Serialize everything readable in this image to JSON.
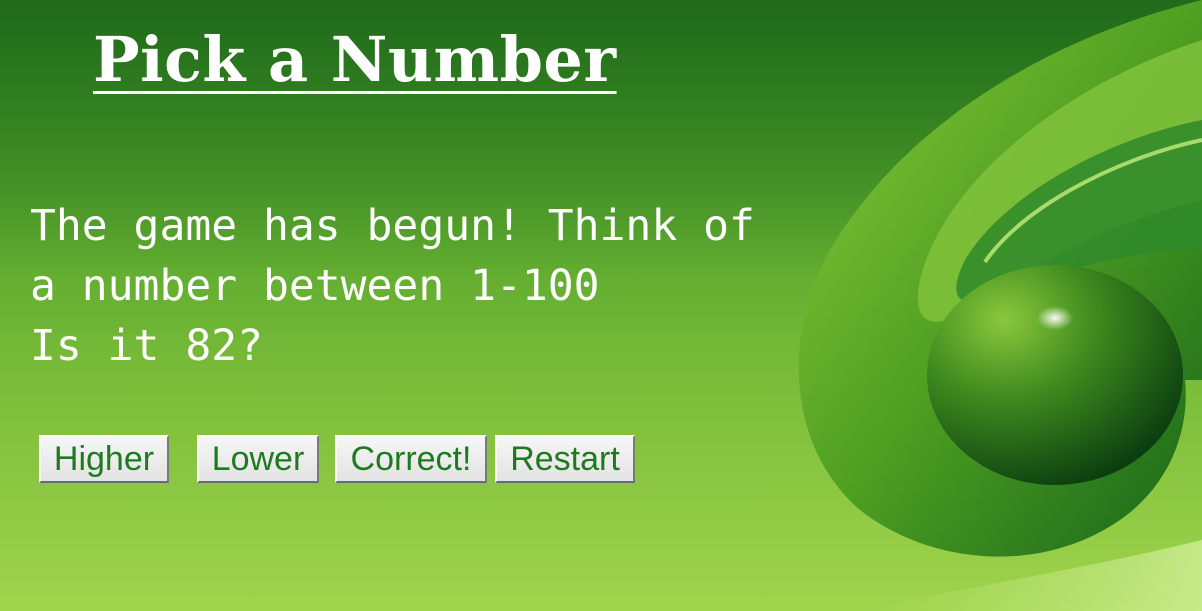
{
  "game": {
    "title": "Pick a Number",
    "message_lines": [
      "The game has begun! Think of",
      "a number between 1-100",
      "Is it 82?"
    ],
    "buttons": {
      "higher": "Higher",
      "lower": "Lower",
      "correct": "Correct!",
      "restart": "Restart"
    }
  },
  "colors": {
    "background_top": "#2f8a22",
    "background_bottom": "#a0d44c",
    "text": "#ffffff",
    "button_text": "#1e7a1e"
  }
}
